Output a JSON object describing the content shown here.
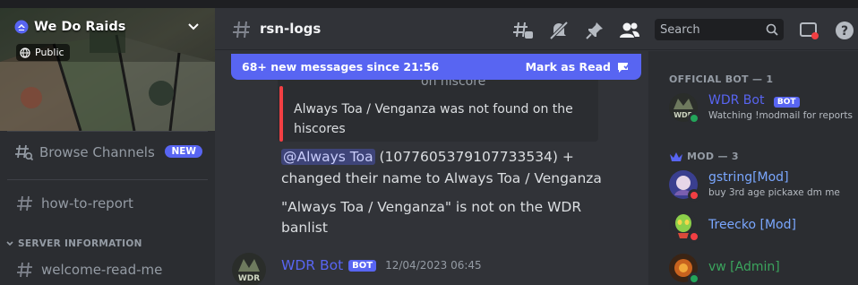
{
  "colors": {
    "brand": "#5865f2",
    "online": "#23a55a",
    "dnd": "#f23f43",
    "mod_name": "#7aa7ff",
    "admin_name": "#3ba55d"
  },
  "server": {
    "name": "We Do Raids",
    "public_label": "Public"
  },
  "sidebar": {
    "browse_channels": "Browse Channels",
    "new_badge": "NEW",
    "channel_how_to_report": "how-to-report",
    "category_server_info": "SERVER INFORMATION",
    "channel_welcome": "welcome-read-me"
  },
  "header": {
    "channel_name": "rsn-logs",
    "search_placeholder": "Search"
  },
  "chat": {
    "new_messages": "68+ new messages since 21:56",
    "mark_as_read": "Mark as Read",
    "embed_title_partial": "on hiscore",
    "embed_description": "Always Toa / Venganza was not found on the hiscores",
    "mention": "@Always Toa",
    "line1_rest": " (1077605379107733534) +",
    "line2": "changed their name to Always Toa / Venganza",
    "line3": "\"Always Toa / Venganza\" is not on the WDR",
    "line4": "banlist",
    "author": "WDR Bot",
    "bot_tag": "BOT",
    "timestamp": "12/04/2023 06:45"
  },
  "members": {
    "cat_official_bot": "OFFICIAL BOT — 1",
    "cat_mod": "MOD — 3",
    "list": [
      {
        "name": "WDR Bot",
        "tag": "BOT",
        "status_text": "Watching !modmail for reports"
      },
      {
        "name": "gstring[Mod]",
        "status_text": "buy 3rd age pickaxe dm me"
      },
      {
        "name": "Treecko [Mod]",
        "status_text": ""
      },
      {
        "name": "vw [Admin]",
        "status_text": ""
      }
    ]
  }
}
